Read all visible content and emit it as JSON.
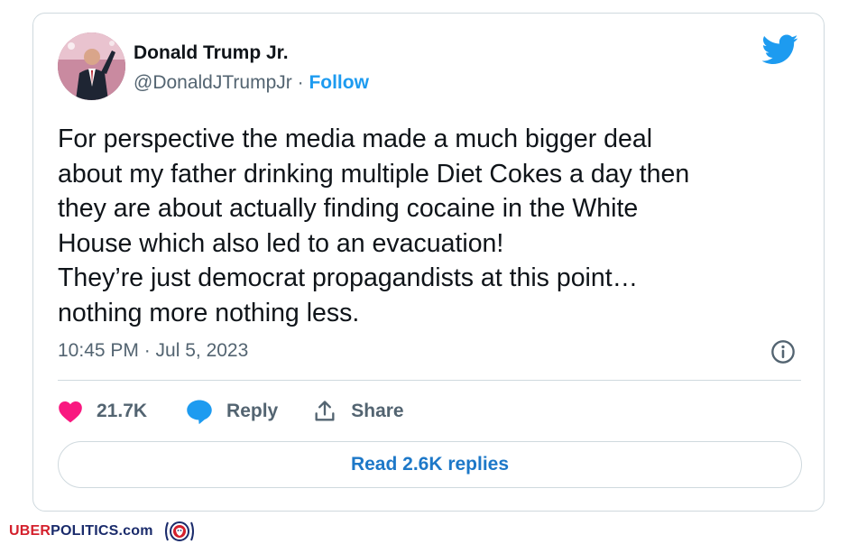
{
  "tweet": {
    "author_name": "Donald Trump Jr.",
    "handle": "@DonaldJTrumpJr",
    "separator": " · ",
    "follow_label": "Follow",
    "text": "For perspective the media made a much bigger deal\nabout my father drinking multiple Diet Cokes a day then\nthey are about actually finding cocaine in the White\nHouse which also led to an evacuation!\nThey’re just democrat propagandists at this point…\nnothing more nothing less.",
    "timestamp": "10:45 PM · Jul 5, 2023",
    "likes": "21.7K",
    "reply_label": "Reply",
    "share_label": "Share",
    "read_replies_label": "Read 2.6K replies"
  },
  "footer": {
    "brand_uber": "UBER",
    "brand_politics": "POLITICS",
    "brand_com": ".com"
  },
  "colors": {
    "accent": "#1d9bf0",
    "like": "#f91880",
    "brand_red": "#d4202c",
    "brand_navy": "#1a2b6b"
  },
  "icons": [
    "twitter-bird-icon",
    "info-icon",
    "heart-icon",
    "reply-bubble-icon",
    "share-icon",
    "seal-logo"
  ]
}
